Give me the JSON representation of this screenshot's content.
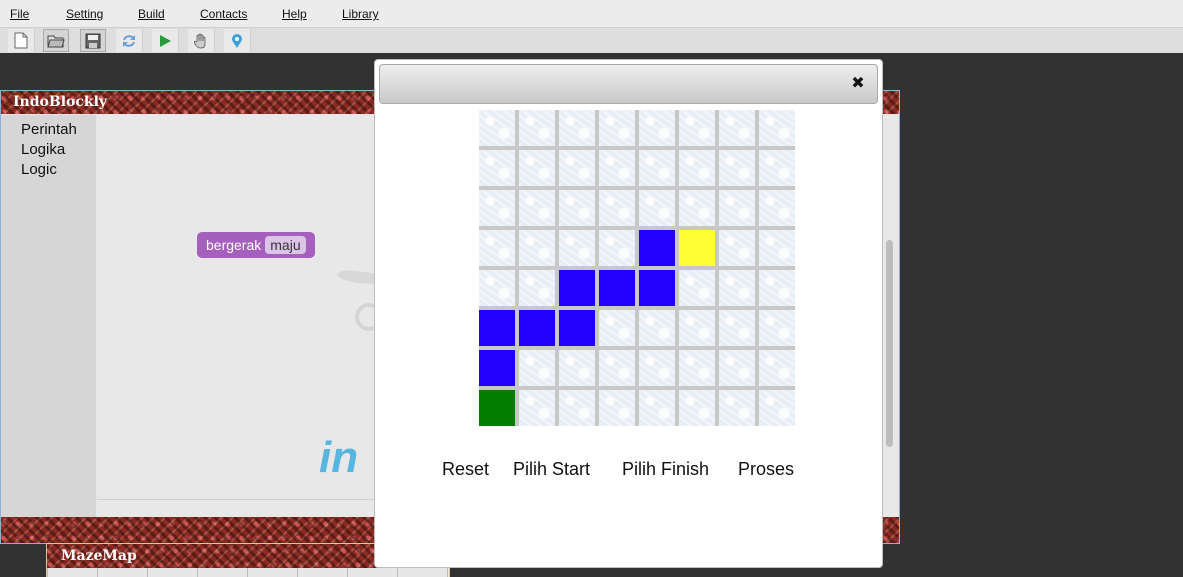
{
  "menu": {
    "items": [
      {
        "label": "File"
      },
      {
        "label": "Setting"
      },
      {
        "label": "Build"
      },
      {
        "label": "Contacts"
      },
      {
        "label": "Help"
      },
      {
        "label": "Library"
      }
    ]
  },
  "toolbar": {
    "buttons": [
      {
        "icon": "new-file-icon"
      },
      {
        "icon": "open-folder-icon"
      },
      {
        "icon": "save-icon"
      },
      {
        "icon": "refresh-icon"
      },
      {
        "icon": "run-icon"
      },
      {
        "icon": "hand-icon"
      },
      {
        "icon": "map-pin-icon"
      }
    ]
  },
  "indoblockly": {
    "title": "IndoBlockly",
    "categories": [
      "Perintah",
      "Logika",
      "Logic"
    ],
    "block": {
      "label": "bergerak",
      "field": "maju"
    },
    "logo_fragment": "in"
  },
  "mazemap": {
    "title": "MazeMap"
  },
  "dialog": {
    "close_glyph": "✖",
    "maze": {
      "rows": 8,
      "cols": 8,
      "start": [
        7,
        0
      ],
      "finish": [
        3,
        5
      ],
      "path": [
        [
          6,
          0
        ],
        [
          5,
          0
        ],
        [
          5,
          1
        ],
        [
          5,
          2
        ],
        [
          4,
          2
        ],
        [
          4,
          3
        ],
        [
          4,
          4
        ],
        [
          3,
          4
        ]
      ]
    },
    "buttons": {
      "reset": "Reset",
      "pick_start": "Pilih Start",
      "pick_finish": "Pilih Finish",
      "process": "Proses"
    }
  },
  "colors": {
    "path": "#2200ff",
    "start": "#047c00",
    "finish": "#ffff33",
    "block": "#a55fbd"
  }
}
